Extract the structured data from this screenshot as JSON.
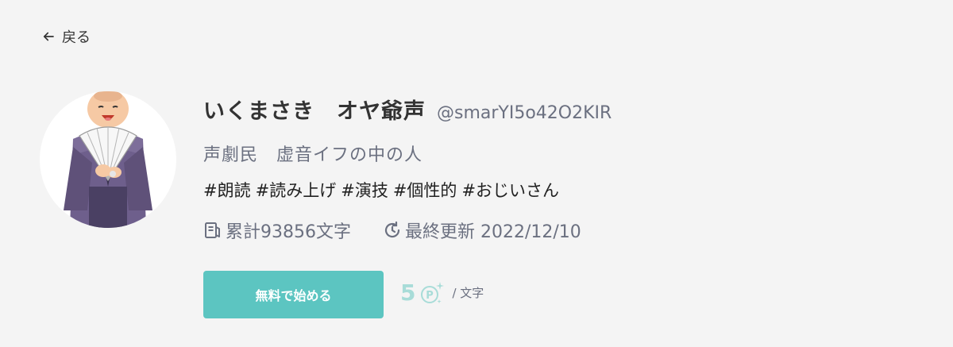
{
  "nav": {
    "back_label": "戻る"
  },
  "profile": {
    "name": "いくまさき　オヤ爺声",
    "handle": "@smarYI5o42O2KIR",
    "bio": "声劇民　虚音イフの中の人",
    "tags": [
      "#朗読",
      "#読み上げ",
      "#演技",
      "#個性的",
      "#おじいさん"
    ]
  },
  "stats": {
    "total_chars": "累計93856文字",
    "last_updated": "最終更新 2022/12/10"
  },
  "cta": {
    "label": "無料で始める"
  },
  "pricing": {
    "amount": "5",
    "unit": "/ 文字"
  },
  "icons": {
    "back": "arrow-left-icon",
    "chars": "document-icon",
    "updated": "history-icon",
    "point": "point-coin-icon"
  },
  "colors": {
    "accent": "#5cc5c1",
    "muted_text": "#6b7080",
    "background": "#f4f4f4"
  }
}
